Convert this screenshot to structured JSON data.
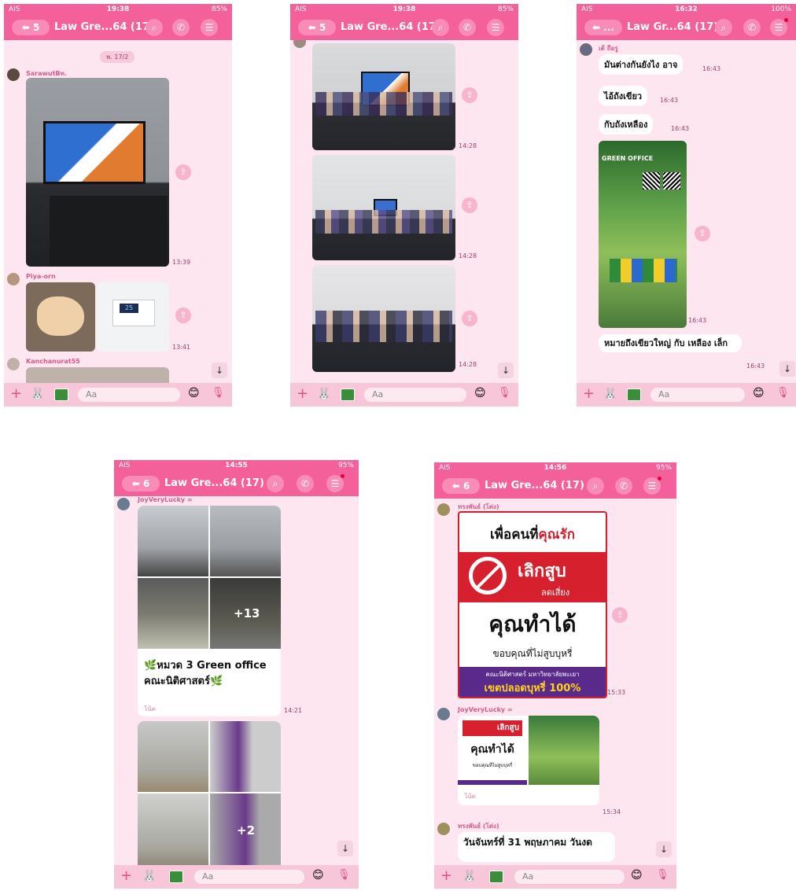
{
  "screens": [
    {
      "status": {
        "carrier": "AIS",
        "time": "19:38",
        "battery": "85%"
      },
      "header": {
        "back": "5",
        "title": "Law Gre...64 (17)"
      },
      "date_chip": "พ. 17/2",
      "messages": [
        {
          "sender": "SarawutBท.",
          "time": "13:39"
        },
        {
          "sender": "Piya-orn",
          "time": "13:41",
          "display": "25"
        },
        {
          "sender": "Kanchanurat55"
        }
      ],
      "input_placeholder": "Aa"
    },
    {
      "status": {
        "carrier": "AIS",
        "time": "19:38",
        "battery": "85%"
      },
      "header": {
        "back": "5",
        "title": "Law Gre...64 (17)"
      },
      "messages": [
        {
          "time": "14:28"
        },
        {
          "time": "14:28"
        },
        {
          "time": "14:28"
        }
      ],
      "input_placeholder": "Aa"
    },
    {
      "status": {
        "carrier": "AIS",
        "time": "16:32",
        "battery": "100%"
      },
      "header": {
        "back": "...",
        "title": "Law Gr...64 (17)"
      },
      "messages": [
        {
          "sender": "เต้ ถือรู",
          "text": "มันต่างกันยังไง อาจ",
          "time": "16:43"
        },
        {
          "text": "ไอ้ถังเขียว",
          "time": "16:43"
        },
        {
          "text": "กับถังเหลือง",
          "time": "16:43"
        },
        {
          "time": "16:43",
          "poster_title": "GREEN OFFICE"
        },
        {
          "text": "หมายถึงเขียวใหญ่ กับ เหลือง เล็ก",
          "time": "16:43"
        }
      ],
      "input_placeholder": "Aa"
    },
    {
      "status": {
        "carrier": "AIS",
        "time": "14:55",
        "battery": "95%"
      },
      "header": {
        "back": "6",
        "title": "Law Gre...64 (17)"
      },
      "messages": [
        {
          "sender": "JoyVeryLucky ∞",
          "overlay": "+13",
          "caption": "🌿หมวด 3  Green office คณะนิติศาสตร์🌿",
          "sub": "โน้ต",
          "time": "14:21"
        },
        {
          "overlay": "+2"
        }
      ],
      "input_placeholder": "Aa"
    },
    {
      "status": {
        "carrier": "AIS",
        "time": "14:56",
        "battery": "95%"
      },
      "header": {
        "back": "6",
        "title": "Law Gre...64 (17)"
      },
      "messages": [
        {
          "sender": "ทรงพันธ์ (โต่ง)",
          "time": "15:33",
          "poster": {
            "line1a": "เพื่อคนที่",
            "line1b": "คุณรัก",
            "quit": "เลิกสูบ",
            "quit_sub": "ลดเสี่ยง",
            "big": "คุณทำได้",
            "thanks": "ขอบคุณที่ไม่สูบบุหรี่",
            "faculty": "คณะนิติศาสตร์ มหาวิทยาลัยพะเยา",
            "zone": "เขตปลอดบุหรี่ 100%"
          }
        },
        {
          "sender": "JoyVeryLucky ∞",
          "time": "15:34",
          "sub": "โน้ต",
          "mini_quit": "เลิกสูบ",
          "mini_big": "คุณทำได้",
          "mini_thanks": "ขอบคุณที่ไม่สูบบุหรี่"
        },
        {
          "sender": "ทรงพันธ์ (โต่ง)",
          "text": "วันจันทร์ที่ 31 พฤษภาคม วันงด"
        }
      ],
      "input_placeholder": "Aa"
    }
  ],
  "colors": {
    "header": "#f4609a",
    "chat_bg": "#fde6ef",
    "input_bar": "#f7c6d9"
  },
  "icons": [
    "search-icon",
    "phone-icon",
    "menu-icon",
    "back-arrow-icon",
    "share-icon",
    "plus-icon",
    "sticker-icon",
    "gallery-icon",
    "emoji-icon",
    "mic-icon",
    "scroll-down-icon"
  ]
}
